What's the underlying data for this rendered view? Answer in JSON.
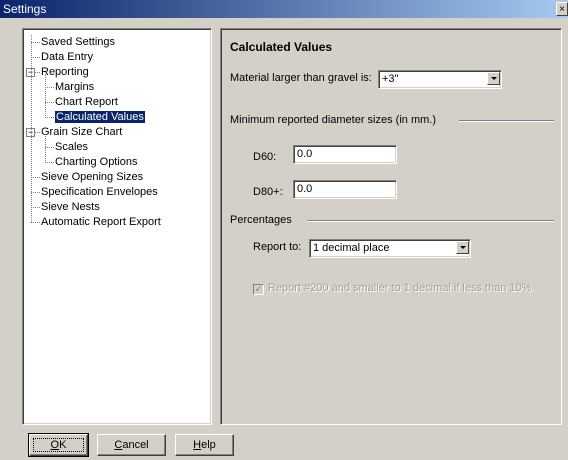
{
  "window": {
    "title": "Settings",
    "close_glyph": "×"
  },
  "tree": {
    "items": [
      {
        "label": "Saved Settings",
        "level": 0,
        "expander": ""
      },
      {
        "label": "Data Entry",
        "level": 0,
        "expander": ""
      },
      {
        "label": "Reporting",
        "level": 0,
        "expander": "−"
      },
      {
        "label": "Margins",
        "level": 1,
        "expander": ""
      },
      {
        "label": "Chart Report",
        "level": 1,
        "expander": ""
      },
      {
        "label": "Calculated Values",
        "level": 1,
        "expander": "",
        "selected": true
      },
      {
        "label": "Grain Size Chart",
        "level": 0,
        "expander": "−"
      },
      {
        "label": "Scales",
        "level": 1,
        "expander": ""
      },
      {
        "label": "Charting Options",
        "level": 1,
        "expander": ""
      },
      {
        "label": "Sieve Opening Sizes",
        "level": 0,
        "expander": ""
      },
      {
        "label": "Specification Envelopes",
        "level": 0,
        "expander": ""
      },
      {
        "label": "Sieve Nests",
        "level": 0,
        "expander": ""
      },
      {
        "label": "Automatic Report Export",
        "level": 0,
        "expander": ""
      }
    ]
  },
  "panel": {
    "title": "Calculated Values",
    "material_label": "Material larger than gravel is:",
    "material_value": "+3\"",
    "min_diameter_group": "Minimum reported diameter sizes (in mm.)",
    "d60_label": "D60:",
    "d60_value": "0.0",
    "d80_label": "D80+:",
    "d80_value": "0.0",
    "percentages_group": "Percentages",
    "report_to_label": "Report to:",
    "report_to_value": "1 decimal place",
    "report200_label": "Report #200 and smaller to 1 decimal if less than 10%",
    "report200_checked": true
  },
  "buttons": {
    "ok": {
      "accel": "O",
      "rest": "K"
    },
    "cancel": {
      "accel": "C",
      "rest": "ancel"
    },
    "help": {
      "accel": "H",
      "rest": "elp"
    }
  }
}
